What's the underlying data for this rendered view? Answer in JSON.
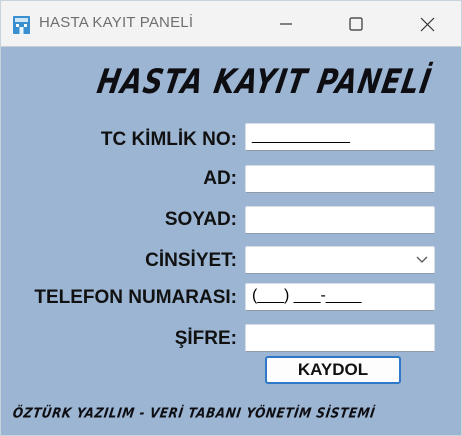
{
  "window": {
    "title": "HASTA KAYIT PANELİ",
    "icon": "hospital-building-icon",
    "controls": [
      "minimize-icon",
      "maximize-icon",
      "close-icon"
    ]
  },
  "form": {
    "heading": "HASTA KAYIT PANELİ",
    "fields": [
      {
        "label": "TC KİMLİK NO:",
        "value": "___________"
      },
      {
        "label": "AD:",
        "value": ""
      },
      {
        "label": "SOYAD:",
        "value": ""
      },
      {
        "label": "CİNSİYET:",
        "value": ""
      },
      {
        "label": "TELEFON NUMARASI:",
        "value": "(___) ___-____"
      },
      {
        "label": "ŞİFRE:",
        "value": ""
      }
    ],
    "submit_label": "KAYDOL"
  },
  "footer": {
    "text": "ÖZTÜRK YAZILIM - VERİ TABANI YÖNETİM SİSTEMİ"
  },
  "colors": {
    "background": "#9bb5d3",
    "titlebar": "#f3f3f3",
    "button_border": "#2f78c7"
  }
}
